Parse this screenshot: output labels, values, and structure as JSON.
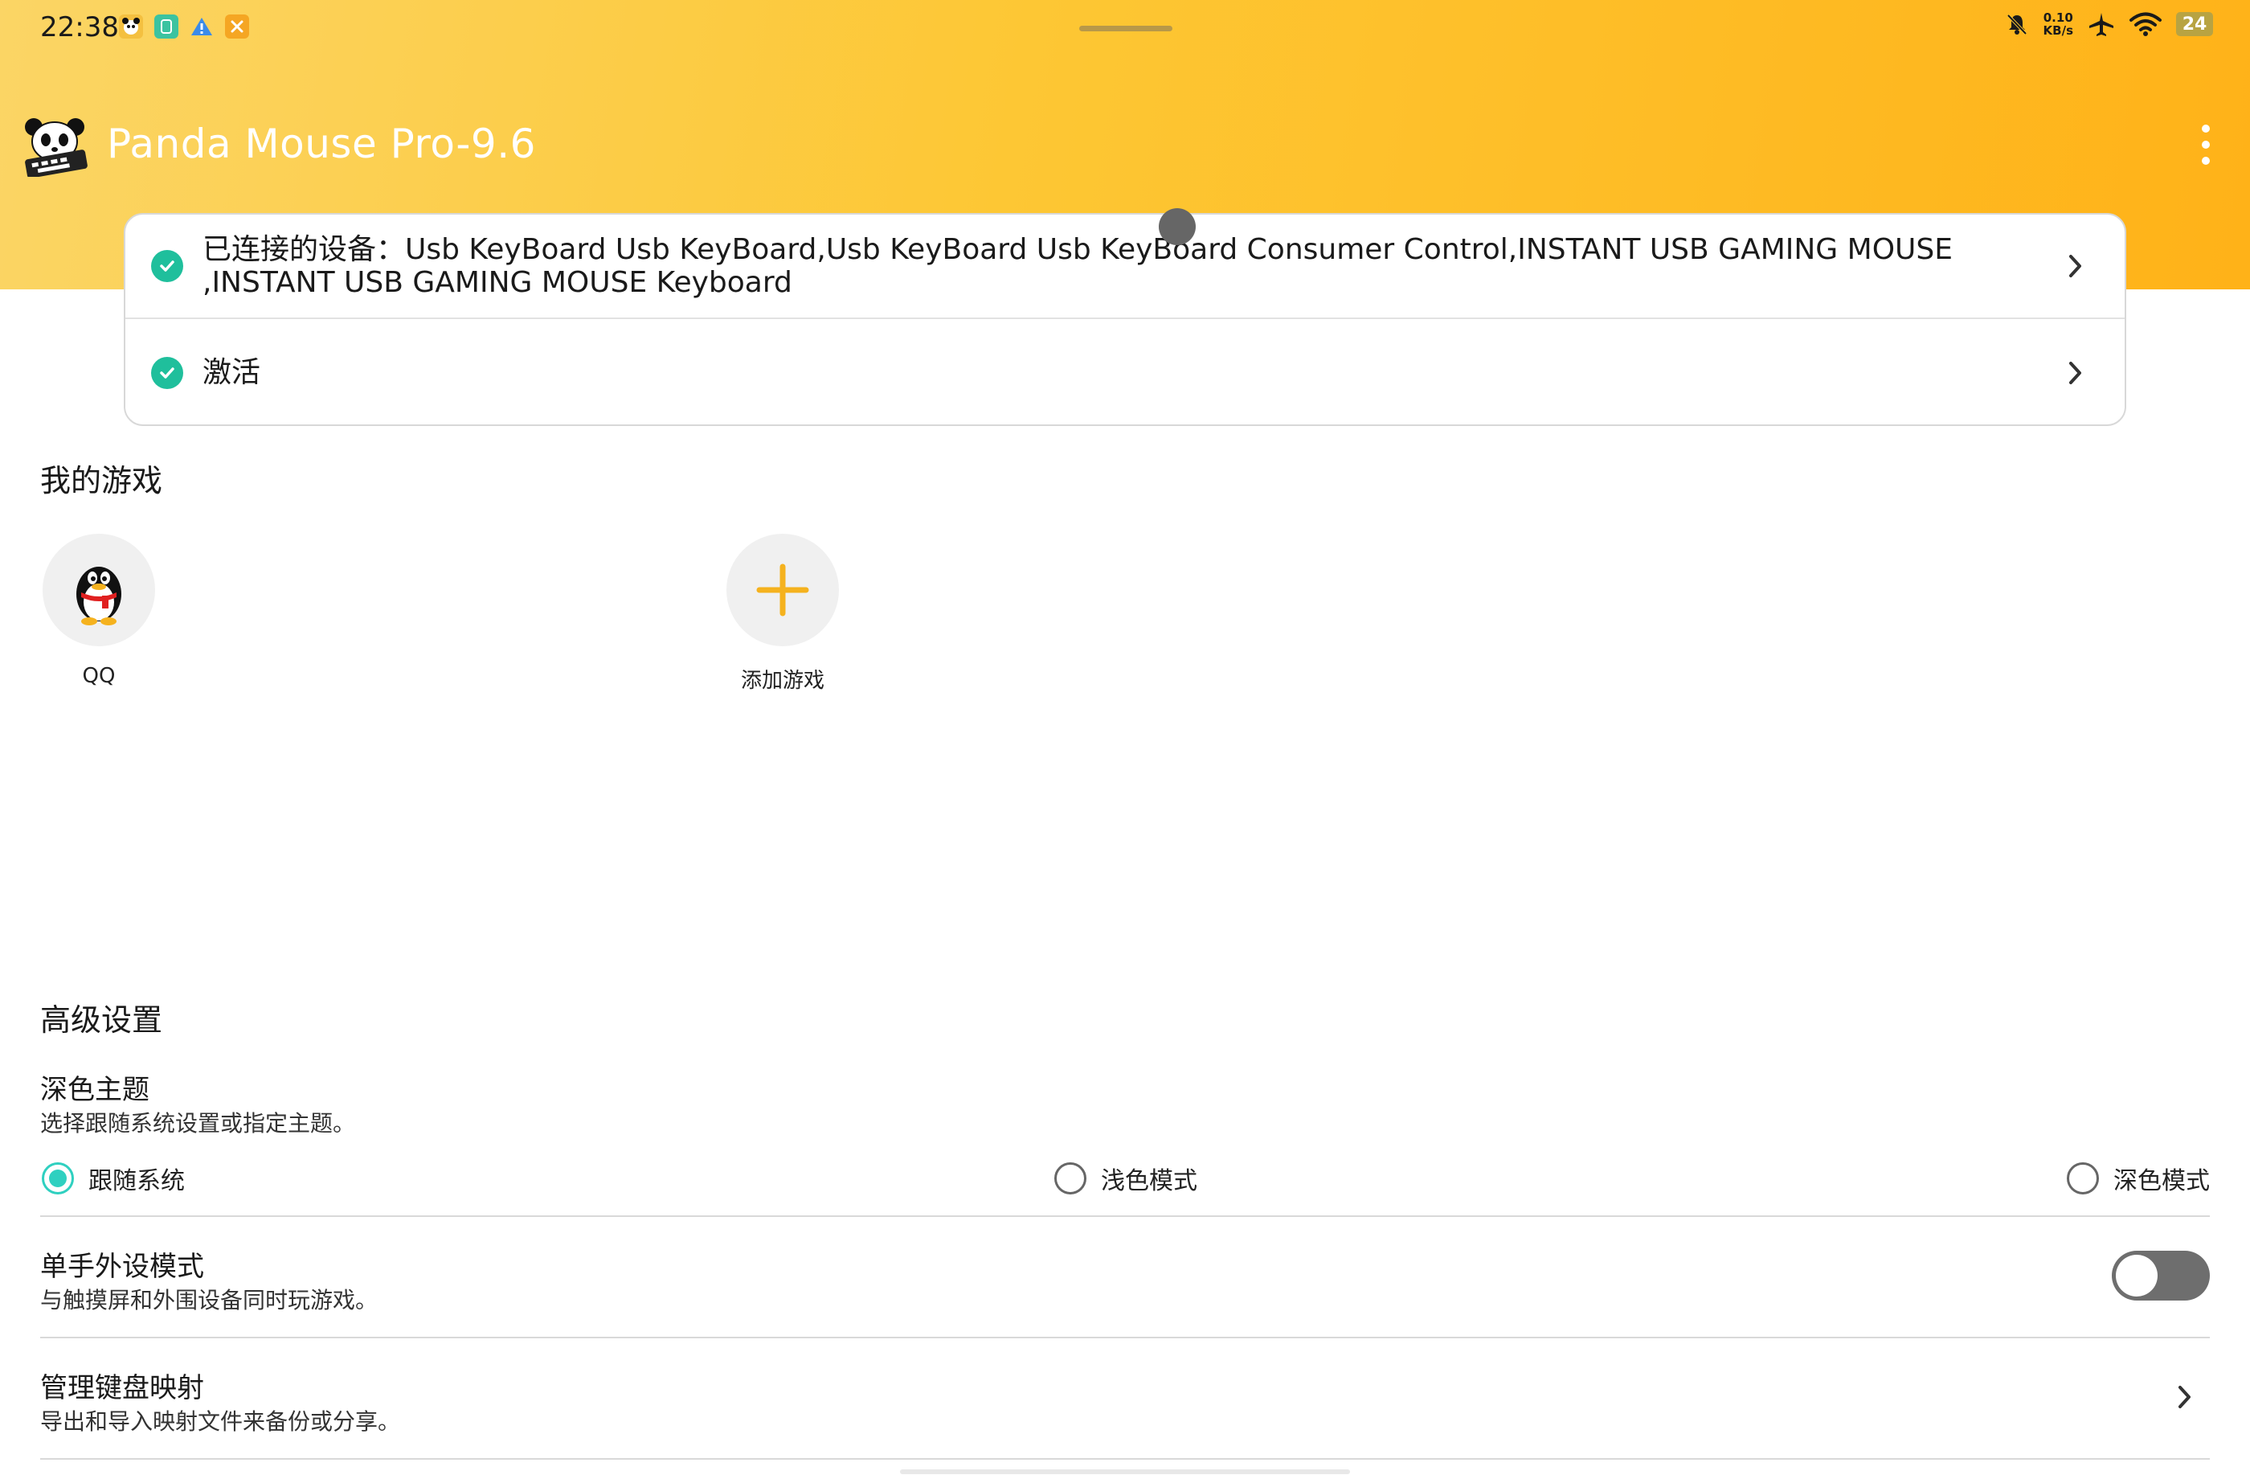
{
  "status_bar": {
    "time": "22:38",
    "net_speed_value": "0.10",
    "net_speed_unit": "KB/s",
    "battery": "24",
    "left_icons": [
      "panda-app-icon",
      "phone-manager-icon",
      "warning-icon",
      "tools-icon"
    ],
    "right_icons": [
      "mute-bell-icon",
      "airplane-icon",
      "wifi-icon",
      "battery-icon"
    ]
  },
  "app": {
    "title": "Panda Mouse Pro-9.6",
    "logo": "panda-keyboard-logo",
    "menu_icon": "more-vertical-icon"
  },
  "status_card": {
    "connected_devices": "已连接的设备：Usb KeyBoard Usb KeyBoard,Usb KeyBoard Usb KeyBoard Consumer Control,INSTANT USB GAMING MOUSE ,INSTANT USB GAMING MOUSE  Keyboard",
    "activation": "激活"
  },
  "my_games": {
    "title": "我的游戏",
    "games": [
      {
        "label": "QQ",
        "icon": "qq-penguin-icon"
      },
      {
        "label": "添加游戏",
        "icon": "add-icon"
      }
    ]
  },
  "advanced": {
    "title": "高级设置",
    "theme": {
      "title": "深色主题",
      "description": "选择跟随系统设置或指定主题。",
      "options": [
        "跟随系统",
        "浅色模式",
        "深色模式"
      ],
      "selected": "跟随系统"
    },
    "one_hand": {
      "title": "单手外设模式",
      "description": "与触摸屏和外围设备同时玩游戏。",
      "enabled": false
    },
    "keymap": {
      "title": "管理键盘映射",
      "description": "导出和导入映射文件来备份或分享。"
    }
  },
  "colors": {
    "header_start": "#fbd565",
    "header_end": "#ffb218",
    "check_green": "#1fbf9c",
    "radio_accent": "#2fd0c0",
    "add_orange": "#f5b21e"
  }
}
